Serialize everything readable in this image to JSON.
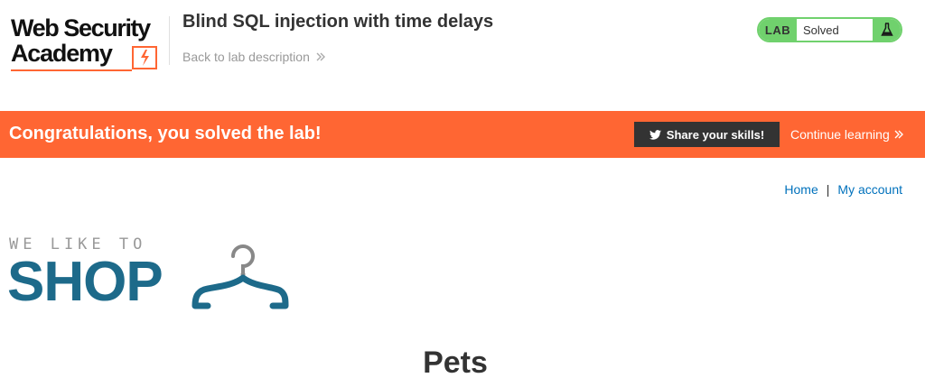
{
  "academy": {
    "logo_line1": "Web Security",
    "logo_line2": "Academy",
    "lab_title": "Blind SQL injection with time delays",
    "back_link": "Back to lab description",
    "lab_tag": "LAB",
    "lab_status": "Solved"
  },
  "banner": {
    "message": "Congratulations, you solved the lab!",
    "share_label": "Share your skills!",
    "continue_label": "Continue learning"
  },
  "nav": {
    "home": "Home",
    "separator": "|",
    "account": "My account"
  },
  "shop_logo": {
    "tagline": "WE LIKE TO",
    "word": "SHOP"
  },
  "page": {
    "heading": "Pets"
  },
  "colors": {
    "brand_orange": "#ff6633",
    "lab_green": "#70d16d",
    "link_blue": "#0071bc",
    "shop_blue": "#1d6a8a"
  },
  "icons": [
    "lightning-bolt-icon",
    "chevrons-right-icon",
    "flask-icon",
    "twitter-icon",
    "hanger-icon"
  ]
}
